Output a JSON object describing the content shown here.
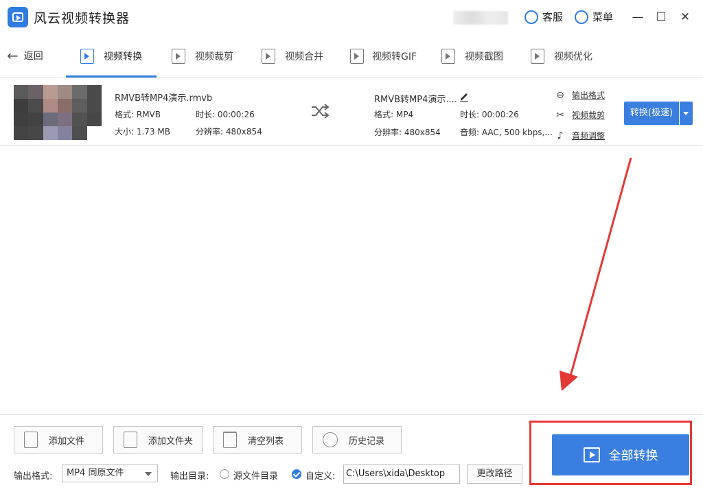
{
  "app": {
    "title": "风云视频转换器"
  },
  "titlebar": {
    "service_label": "客服",
    "menu_label": "菜单",
    "minimize": "—",
    "maximize": "☐",
    "close": "✕"
  },
  "nav": {
    "back_label": "返回",
    "tabs": [
      {
        "label": "视频转换",
        "icon": "video-convert-icon",
        "active": true
      },
      {
        "label": "视频裁剪",
        "icon": "video-crop-icon",
        "active": false
      },
      {
        "label": "视频合并",
        "icon": "video-merge-icon",
        "active": false
      },
      {
        "label": "视频转GIF",
        "icon": "gif-icon",
        "active": false
      },
      {
        "label": "视频截图",
        "icon": "screenshot-icon",
        "active": false
      },
      {
        "label": "视频优化",
        "icon": "optimize-icon",
        "active": false
      }
    ]
  },
  "file": {
    "source": {
      "name": "RMVB转MP4演示.rmvb",
      "format": "格式: RMVB",
      "duration": "时长: 00:00:26",
      "size": "大小: 1.73 MB",
      "resolution": "分辨率: 480x854"
    },
    "output": {
      "name": "RMVB转MP4演示....",
      "format": "格式: MP4",
      "duration": "时长: 00:00:26",
      "resolution": "分辨率: 480x854",
      "audio": "音频: AAC, 500 kbps,..."
    },
    "links": {
      "output_format": "输出格式",
      "video_crop": "视频裁剪",
      "audio_adjust": "音频调整"
    },
    "convert_label": "转换(极速)"
  },
  "bottom": {
    "add_file": "添加文件",
    "add_folder": "添加文件夹",
    "clear_list": "清空列表",
    "history": "历史记录",
    "output_format_label": "输出格式:",
    "output_format_value": "MP4 同原文件",
    "output_dir_label": "输出目录:",
    "source_dir_label": "源文件目录",
    "custom_label": "自定义:",
    "path_value": "C:\\Users\\xida\\Desktop",
    "change_path": "更改路径",
    "convert_all": "全部转换"
  },
  "colors": {
    "accent": "#3a7fe0",
    "highlight": "#e53935"
  }
}
